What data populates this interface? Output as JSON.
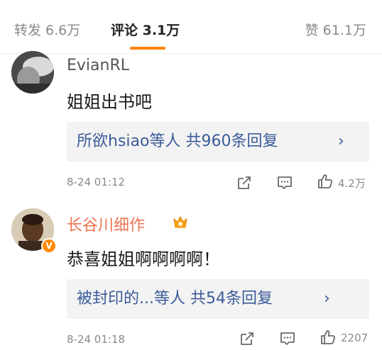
{
  "tabs": {
    "repost": "转发 6.6万",
    "comments": "评论 3.1万",
    "likes": "赞 61.1万"
  },
  "colors": {
    "accent": "#ff8200",
    "link": "#3b5b9a",
    "vip_name": "#eb7350",
    "reply_bg": "#f3f3f3"
  },
  "comments": [
    {
      "username": "EvianRL",
      "text": "姐姐出书吧",
      "reply_summary": "所欲hsiao等人 共960条回复",
      "time": "8-24 01:12",
      "likes": "4.2万"
    },
    {
      "username": "长谷川细作",
      "text": "恭喜姐姐啊啊啊啊！",
      "reply_summary": "被封印的...等人 共54条回复",
      "time": "8-24 01:18",
      "likes": "2207",
      "verified_badge": "V"
    }
  ]
}
